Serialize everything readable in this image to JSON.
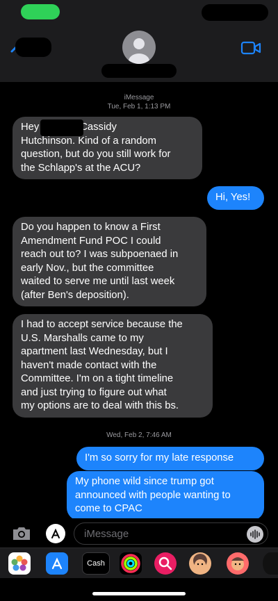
{
  "header": {
    "contact_icon": "person-silhouette-icon",
    "video_icon": "video-call-icon"
  },
  "thread": {
    "service_label": "iMessage",
    "timestamp_1": "Tue, Feb 1, 1:13 PM",
    "timestamp_2": "Wed, Feb 2, 7:46 AM",
    "messages": [
      {
        "from": "them",
        "lines": [
          "Hey        ! This is Cassidy",
          "Hutchinson. Kind of a random",
          "question, but do you still work for",
          "the Schlapp's at the ACU?"
        ]
      },
      {
        "from": "me",
        "lines": [
          "Hi, Yes!"
        ]
      },
      {
        "from": "them",
        "lines": [
          "Do you happen to know a First",
          "Amendment Fund POC I could",
          "reach out to? I was subpoenaed in",
          "early Nov., but the committee",
          "waited to serve me until last week",
          "(after Ben's deposition)."
        ]
      },
      {
        "from": "them",
        "lines": [
          "I had to accept service because the",
          "U.S. Marshalls came to my",
          "apartment last Wednesday, but I",
          "haven't made contact with the",
          "Committee. I'm on a tight timeline",
          "and just trying to figure out what",
          "my options are to deal with this bs."
        ]
      },
      {
        "from": "me",
        "lines": [
          "I'm so sorry for my late response"
        ]
      },
      {
        "from": "me",
        "lines": [
          "My phone wild since trump got",
          "announced with people wanting to",
          "come to CPAC"
        ]
      }
    ]
  },
  "compose": {
    "placeholder": "iMessage"
  },
  "tray": {
    "apps": [
      "photos-icon",
      "app-store-icon",
      "apple-cash-icon",
      "activity-icon",
      "image-search-icon",
      "memoji-icon",
      "memoji-stickers-icon"
    ],
    "cash_label": "Cash"
  },
  "colors": {
    "incoming_bubble": "#3a3a3c",
    "outgoing_bubble": "#1d84fc",
    "background": "#000000",
    "header": "#1c1c1e"
  }
}
